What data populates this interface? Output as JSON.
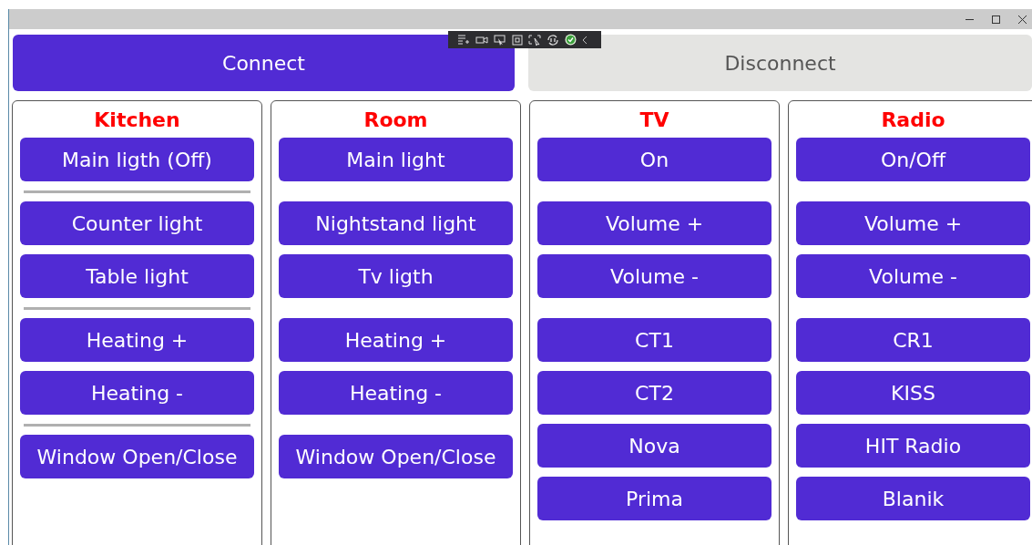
{
  "top_buttons": [
    {
      "label": "Connect",
      "disabled": false
    },
    {
      "label": "Disconnect",
      "disabled": true
    }
  ],
  "panels": [
    {
      "title": "Kitchen",
      "items": [
        {
          "kind": "button",
          "label": "Main ligth (Off)"
        },
        {
          "kind": "separator"
        },
        {
          "kind": "button",
          "label": "Counter light"
        },
        {
          "kind": "button",
          "label": "Table light"
        },
        {
          "kind": "separator"
        },
        {
          "kind": "button",
          "label": "Heating +"
        },
        {
          "kind": "button",
          "label": "Heating -"
        },
        {
          "kind": "separator"
        },
        {
          "kind": "button",
          "label": "Window Open/Close"
        }
      ]
    },
    {
      "title": "Room",
      "items": [
        {
          "kind": "button",
          "label": "Main light"
        },
        {
          "kind": "spacer"
        },
        {
          "kind": "button",
          "label": "Nightstand light"
        },
        {
          "kind": "button",
          "label": "Tv ligth"
        },
        {
          "kind": "spacer"
        },
        {
          "kind": "button",
          "label": "Heating +"
        },
        {
          "kind": "button",
          "label": "Heating -"
        },
        {
          "kind": "spacer"
        },
        {
          "kind": "button",
          "label": "Window Open/Close"
        }
      ]
    },
    {
      "title": "TV",
      "items": [
        {
          "kind": "button",
          "label": "On"
        },
        {
          "kind": "spacer"
        },
        {
          "kind": "button",
          "label": "Volume +"
        },
        {
          "kind": "button",
          "label": "Volume -"
        },
        {
          "kind": "spacer"
        },
        {
          "kind": "button",
          "label": "CT1"
        },
        {
          "kind": "button",
          "label": "CT2"
        },
        {
          "kind": "button",
          "label": "Nova"
        },
        {
          "kind": "button",
          "label": "Prima"
        }
      ]
    },
    {
      "title": "Radio",
      "items": [
        {
          "kind": "button",
          "label": "On/Off"
        },
        {
          "kind": "spacer"
        },
        {
          "kind": "button",
          "label": "Volume +"
        },
        {
          "kind": "button",
          "label": "Volume -"
        },
        {
          "kind": "spacer"
        },
        {
          "kind": "button",
          "label": "CR1"
        },
        {
          "kind": "button",
          "label": "KISS"
        },
        {
          "kind": "button",
          "label": "HIT Radio"
        },
        {
          "kind": "button",
          "label": "Blanik"
        }
      ]
    }
  ]
}
